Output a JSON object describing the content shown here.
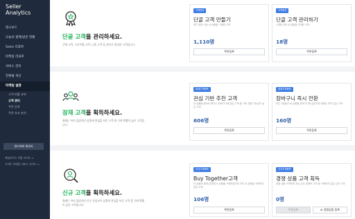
{
  "brand": {
    "line1": "Seller",
    "line2": "Analytics"
  },
  "sidebar": {
    "items": [
      {
        "label": "대시보드"
      },
      {
        "label": "오늘의 결제/방문 현황"
      },
      {
        "label": "Sales 리포트"
      },
      {
        "label": "마케팅 리포트"
      },
      {
        "label": "서비스 관리"
      },
      {
        "label": "전환율 개선"
      },
      {
        "label": "마케팅 설명"
      }
    ],
    "sub_items": [
      {
        "label": "고객 현황 요약"
      },
      {
        "label": "고객 관리"
      },
      {
        "label": "쿠폰 등록"
      },
      {
        "label": "쿠폰 효과 분석"
      }
    ],
    "button_label": "셀러에게 메세지",
    "links": [
      "애널리틱스 이용 가이드 >",
      "스마트 마케팅 서비스 가이드 >"
    ]
  },
  "sections": [
    {
      "headline_accent": "단골 고객",
      "headline_rest": "을 관리하세요.",
      "desc": "구매 고객, 스토어찜 고객, 나중 고객 등 관리가 필요한 고객입니다.",
      "cards": [
        {
          "tag": "고객관리",
          "title": "단골 고객 만들기",
          "desc": "최근 한번 이상 내 상품을 구매한 고객",
          "count": "1,110명",
          "button": "쿠폰등록"
        },
        {
          "tag": "고객관리",
          "title": "단골 고객 관리하기",
          "desc": "2개월 안에 내 상품을 구매한 고객",
          "count": "18명",
          "button": "쿠폰등록"
        }
      ]
    },
    {
      "headline_accent": "잠재 고객",
      "headline_rest": "을 획득하세요.",
      "desc": "결제는 하지 않았지만 상품에 관심을 보인 고객 중 구매 확률이 높은 고객입니다.",
      "cards": [
        {
          "tag": "잠재고객획득",
          "title": "관심 기반 추천 고객",
          "desc": "내 상품을 좋아요 했거나 장바구니에 담은 고객 중 구매 전환 가능성이 높은 고객",
          "count": "606명",
          "button": "쿠폰등록"
        },
        {
          "tag": "잠재고객획득",
          "title": "장바구니 즉시 전환",
          "desc": "최근 1달동안 내 상품을 장바구니에 담았지만 결제는 하지 않은 고객",
          "count": "160명",
          "button": "쿠폰등록"
        }
      ]
    },
    {
      "headline_accent": "신규 고객",
      "headline_rest": "을 획득하세요.",
      "desc": "결제는 하지 않았지만 신규 유입되어 상품에 관심을 보인 고객 중 구매 확률이 높은 고객입니다.",
      "cards": [
        {
          "tag": "신규고객획득",
          "title": "Buy Together고객",
          "desc": "내 상품과 함께 잘 팔리는 상품을 구매하였지만 아직 내 상품을 구매하지 않은 고객",
          "count": "106명",
          "button": "쿠폰등록"
        },
        {
          "tag": "신규고객획득",
          "title": "경쟁 상품 고객 획득",
          "desc": "경쟁 상품 구매하여 관심 있는 잠재적 고객 중 구매하지 않은 신규 고객",
          "count": "0명",
          "button": "쿠폰등록",
          "button2": "경쟁상품 등록"
        }
      ]
    }
  ],
  "colors": {
    "accent_green": "#21b35a",
    "tag_blue": "#3c7be3",
    "sidebar_bg": "#1f2a3c",
    "count_blue": "#2f5fa8"
  }
}
